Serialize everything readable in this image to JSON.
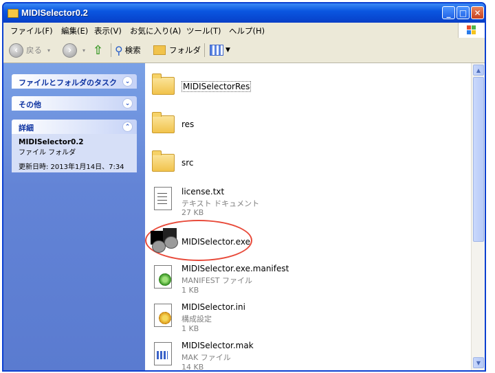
{
  "window": {
    "title": "MIDISelector0.2",
    "minimize": "_",
    "maximize": "□",
    "close": "✕"
  },
  "menu": [
    {
      "label": "ファイル(F)"
    },
    {
      "label": "編集(E)"
    },
    {
      "label": "表示(V)"
    },
    {
      "label": "お気に入り(A)"
    },
    {
      "label": "ツール(T)"
    },
    {
      "label": "ヘルプ(H)"
    }
  ],
  "toolbar": {
    "back_label": "戻る",
    "back_icon": "back-arrow-icon",
    "forward_icon": "forward-arrow-icon",
    "up_icon": "up-folder-icon",
    "search_label": "検索",
    "search_icon": "search-icon",
    "folders_label": "フォルダ",
    "folders_icon": "folder-icon",
    "views_icon": "views-icon"
  },
  "sidebar": {
    "tasks_label": "ファイルとフォルダのタスク",
    "other_label": "その他",
    "details_label": "詳細",
    "details": {
      "name": "MIDISelector0.2",
      "type": "ファイル フォルダ",
      "modified": "更新日時: 2013年1月14日、7:34"
    }
  },
  "files": [
    {
      "name": "MIDISelectorRes",
      "kind": "folder"
    },
    {
      "name": "res",
      "kind": "folder"
    },
    {
      "name": "src",
      "kind": "folder"
    },
    {
      "name": "license.txt",
      "type": "テキスト ドキュメント",
      "size": "27 KB",
      "kind": "text"
    },
    {
      "name": "MIDISelector.exe",
      "kind": "app"
    },
    {
      "name": "MIDISelector.exe.manifest",
      "type": "MANIFEST ファイル",
      "size": "1 KB",
      "kind": "manifest"
    },
    {
      "name": "MIDISelector.ini",
      "type": "構成設定",
      "size": "1 KB",
      "kind": "ini"
    },
    {
      "name": "MIDISelector.mak",
      "type": "MAK ファイル",
      "size": "14 KB",
      "kind": "mak"
    }
  ],
  "colors": {
    "titlebar": "#0a56e0",
    "sidebar": "#6384d6",
    "highlight_circle": "#e84a3a"
  }
}
